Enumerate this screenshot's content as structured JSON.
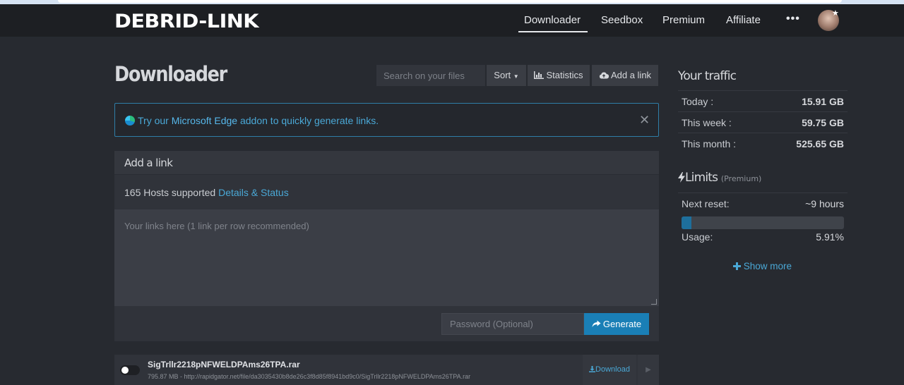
{
  "nav": {
    "logo_text": "DEBRID-LINK",
    "items": [
      "Downloader",
      "Seedbox",
      "Premium",
      "Affiliate"
    ],
    "more": "•••"
  },
  "page": {
    "title": "Downloader",
    "search_placeholder": "Search on your files",
    "sort_label": "Sort",
    "statistics_label": "Statistics",
    "add_link_label": "Add a link"
  },
  "alert": {
    "prefix": "Try our ",
    "link": "Microsoft Edge",
    "suffix": " addon to quickly generate links."
  },
  "add_link": {
    "title": "Add a link",
    "hosts_text": "165 Hosts supported ",
    "hosts_link": "Details & Status",
    "textarea_placeholder": "Your links here (1 link per row recommended)",
    "password_placeholder": "Password (Optional)",
    "generate_label": "Generate"
  },
  "file": {
    "name": "SigTrllr2218pNFWELDPAms26TPA.rar",
    "meta": "795.87 MB - http://rapidgator.net/file/da3035430b8de26c3f8d85f8941bd9c0/SigTrllr2218pNFWELDPAms26TPA.rar",
    "download_label": "Download"
  },
  "traffic": {
    "title": "Your traffic",
    "rows": [
      {
        "label": "Today :",
        "value": "15.91 GB"
      },
      {
        "label": "This week :",
        "value": "59.75 GB"
      },
      {
        "label": "This month :",
        "value": "525.65 GB"
      }
    ]
  },
  "limits": {
    "title": "Limits",
    "tag": "(Premium)",
    "next_reset_label": "Next reset:",
    "next_reset_value": "~9 hours",
    "usage_label": "Usage:",
    "usage_value": "5.91%",
    "usage_fraction": 0.0591,
    "show_more": "Show more"
  },
  "colors": {
    "accent": "#1a7fb6",
    "link": "#4aa8d6",
    "background": "#272a30"
  }
}
